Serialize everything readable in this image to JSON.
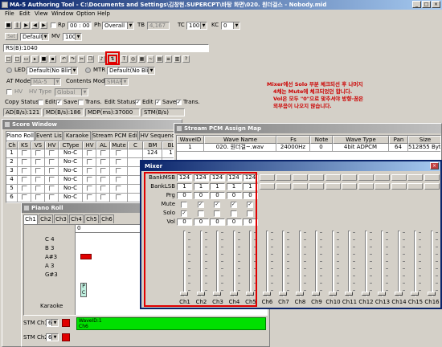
{
  "app": {
    "title": "MA-5 Authoring Tool - C:\\Documents and Settings\\김창현.SUPERCPT\\바탕 화면\\020. 원더걸스 - Nobody.mid",
    "menu": [
      "File",
      "Edit",
      "View",
      "Window",
      "Option",
      "Help"
    ]
  },
  "transport": {
    "rp_label": "Rp",
    "rp_value": "00 : 00 : 00",
    "ph_label": "Ph",
    "ph_value": "Overall",
    "tb_label": "TB",
    "tb_value": "4,167",
    "tc_label": "TC",
    "tc_value": "100",
    "kc_label": "KC",
    "kc_value": "0",
    "set_label": "Set",
    "default_value": "Default",
    "mv_label": "MV",
    "mv_value": "100"
  },
  "rs_field": "RS(B):1040",
  "led": {
    "label": "LED",
    "value": "Default(No Blink)",
    "mtr_label": "MTR",
    "mtr_value": "Default(No Blink)"
  },
  "at_mode": {
    "label": "AT Mode",
    "value": "MA-5",
    "contents_label": "Contents Mode",
    "contents_value": "SMAF"
  },
  "hv": {
    "label": "HV",
    "type_label": "HV Type",
    "type_value": "Global"
  },
  "copy_status": {
    "label": "Copy Status",
    "items": [
      {
        "label": "Edit",
        "checked": false
      },
      {
        "label": "Save",
        "checked": true
      },
      {
        "label": "Trans.",
        "checked": false
      }
    ],
    "edit_label": "Edit Status",
    "edit_items": [
      {
        "label": "Edit",
        "checked": true
      },
      {
        "label": "Save",
        "checked": true
      },
      {
        "label": "Trans.",
        "checked": true
      }
    ]
  },
  "status_row": [
    "AD(B/s):121",
    "MD(B/s):186",
    "MDP(ms):37000",
    "STM(B/s)"
  ],
  "annotation": {
    "line1": "Mixer에선 Solo 부분 체크되선 후 나머지",
    "line2": "4채는 Mute에 체크되었던 합니다.",
    "line3": "Vol은 모두 \"0\"으로 맞추셔야 방향-꿈은",
    "line4": "외부음이 나오지 않습니다."
  },
  "score_window": {
    "title": "Score Window",
    "tabs": [
      "Piano Roll",
      "Event List",
      "Karaoke",
      "Stream PCM Edit",
      "HV Sequence"
    ],
    "columns": [
      "Ch",
      "KS",
      "VS",
      "HV",
      "CType",
      "HV",
      "AL",
      "Mute",
      "C",
      "BM",
      "BL"
    ],
    "rows": [
      {
        "ch": "1",
        "ctype": "No-C",
        "bm": "124",
        "bl": "1"
      },
      {
        "ch": "2",
        "ctype": "No-C",
        "bm": "",
        "bl": ""
      },
      {
        "ch": "3",
        "ctype": "No-C",
        "bm": "",
        "bl": ""
      },
      {
        "ch": "4",
        "ctype": "No-C",
        "bm": "",
        "bl": ""
      },
      {
        "ch": "5",
        "ctype": "No-C",
        "bm": "",
        "bl": ""
      },
      {
        "ch": "6",
        "ctype": "No-C",
        "bm": "",
        "bl": ""
      }
    ]
  },
  "piano_roll": {
    "title": "Piano Roll",
    "channels": [
      "Ch1",
      "Ch2",
      "Ch3",
      "Ch4",
      "Ch5",
      "Ch6"
    ],
    "ruler_value": "0",
    "notes": [
      "C 4",
      "B 3",
      "A#3",
      "A 3",
      "G#3"
    ],
    "marker_p": "P",
    "marker_c": "C",
    "karaoke_label": "Karaoke",
    "stm_rows": [
      {
        "label": "STM Ch1",
        "value": "6",
        "bar_label": "WaveID:1",
        "bar_sub": "Ch6"
      },
      {
        "label": "STM Ch2",
        "value": "6"
      }
    ]
  },
  "stream_pcm": {
    "title": "Stream PCM Assign Map",
    "columns": [
      "WaveID",
      "Wave Name",
      "Fs",
      "Note",
      "Wave Type",
      "Pan",
      "Size"
    ],
    "rows": [
      {
        "id": "1",
        "name": "020. 원더걸~.wav",
        "fs": "24000Hz",
        "note": "0",
        "type": "4bit ADPCM",
        "pan": "64",
        "size": "512855 Byte"
      }
    ]
  },
  "mixer": {
    "title": "Mixer",
    "row_labels": [
      "BankMSB",
      "BankLSB",
      "Prg",
      "Mute",
      "Solo",
      "Vol"
    ],
    "channels": [
      {
        "name": "Ch1",
        "msb": "124",
        "lsb": "1",
        "prg": "0",
        "mute": false,
        "solo": true,
        "vol": "0"
      },
      {
        "name": "Ch2",
        "msb": "124",
        "lsb": "1",
        "prg": "0",
        "mute": true,
        "solo": false,
        "vol": "0"
      },
      {
        "name": "Ch3",
        "msb": "124",
        "lsb": "1",
        "prg": "0",
        "mute": true,
        "solo": false,
        "vol": "0"
      },
      {
        "name": "Ch4",
        "msb": "124",
        "lsb": "1",
        "prg": "0",
        "mute": true,
        "solo": false,
        "vol": "0"
      },
      {
        "name": "Ch5",
        "msb": "124",
        "lsb": "1",
        "prg": "0",
        "mute": true,
        "solo": false,
        "vol": "0"
      },
      {
        "name": "Ch6"
      },
      {
        "name": "Ch7"
      },
      {
        "name": "Ch8"
      },
      {
        "name": "Ch9"
      },
      {
        "name": "Ch10"
      },
      {
        "name": "Ch11"
      },
      {
        "name": "Ch12"
      },
      {
        "name": "Ch13"
      },
      {
        "name": "Ch14"
      },
      {
        "name": "Ch15"
      },
      {
        "name": "Ch16"
      }
    ]
  },
  "colors": {
    "title_active": "#0a246a",
    "highlight_red": "#e00000",
    "annotation_text": "#cc0000",
    "stm_bar": "#00e000"
  }
}
